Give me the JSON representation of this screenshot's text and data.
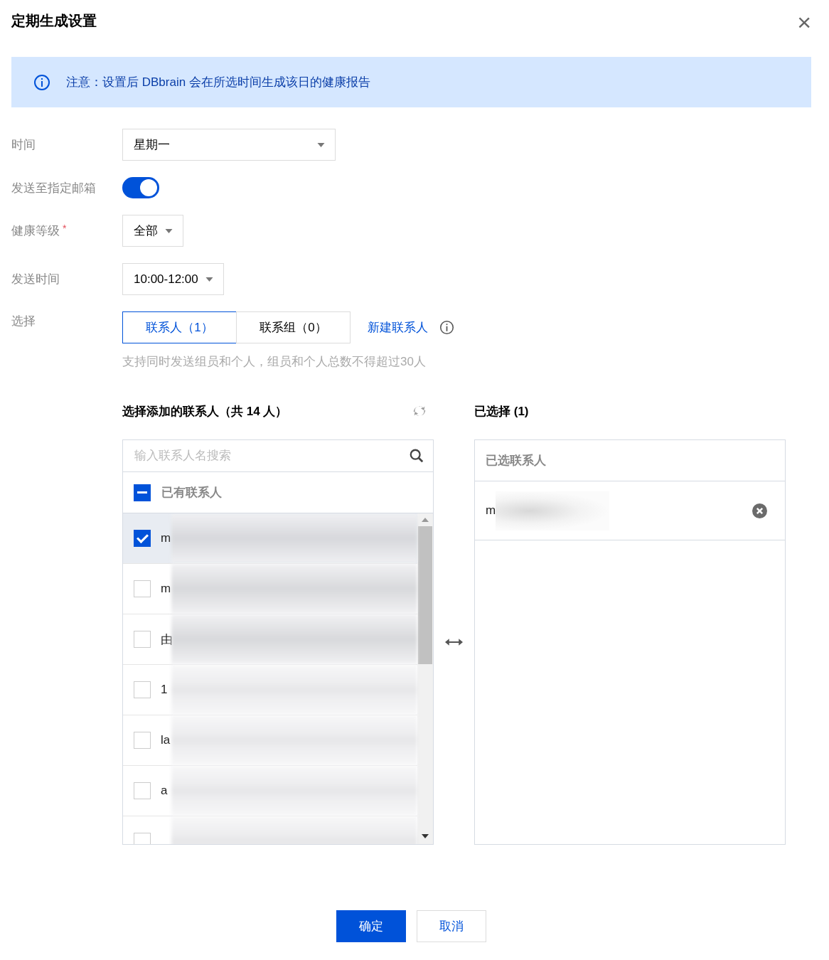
{
  "dialog": {
    "title": "定期生成设置",
    "close": "×"
  },
  "notice": {
    "text": "注意：设置后 DBbrain 会在所选时间生成该日的健康报告"
  },
  "form": [
    {
      "kind": "select",
      "label": "时间",
      "value": "星期一",
      "wide": true
    },
    {
      "kind": "toggle",
      "label": "发送至指定邮箱",
      "on": true
    },
    {
      "kind": "select",
      "label": "健康等级",
      "required_mark": "*",
      "value": "全部",
      "wide": false
    },
    {
      "kind": "select",
      "label": "发送时间",
      "value": "10:00-12:00",
      "wide": false
    }
  ],
  "selection": {
    "label": "选择",
    "tabs": [
      {
        "label": "联系人（1）",
        "selected": true
      },
      {
        "label": "联系组（0）",
        "selected": false
      }
    ],
    "link": "新建联系人",
    "hint": "支持同时发送组员和个人，组员和个人总数不得超过30人"
  },
  "source": {
    "title": "选择添加的联系人（共 14 人）",
    "search_placeholder": "输入联系人名搜索",
    "group": {
      "label": "已有联系人",
      "indeterminate": true
    },
    "rows": [
      {
        "text": "m",
        "checked": true
      },
      {
        "text": "m",
        "checked": false
      },
      {
        "text": "由",
        "checked": false
      },
      {
        "text": "1",
        "checked": false
      },
      {
        "text": "la",
        "checked": false
      },
      {
        "text": "a",
        "checked": false
      },
      {
        "checked": false
      }
    ]
  },
  "target": {
    "title": "已选择 (1)",
    "header": "已选联系人",
    "items": [
      {
        "text": "m"
      }
    ]
  },
  "buttons": [
    {
      "label": "确定",
      "kind": "primary"
    },
    {
      "label": "取消",
      "kind": "secondary"
    }
  ]
}
